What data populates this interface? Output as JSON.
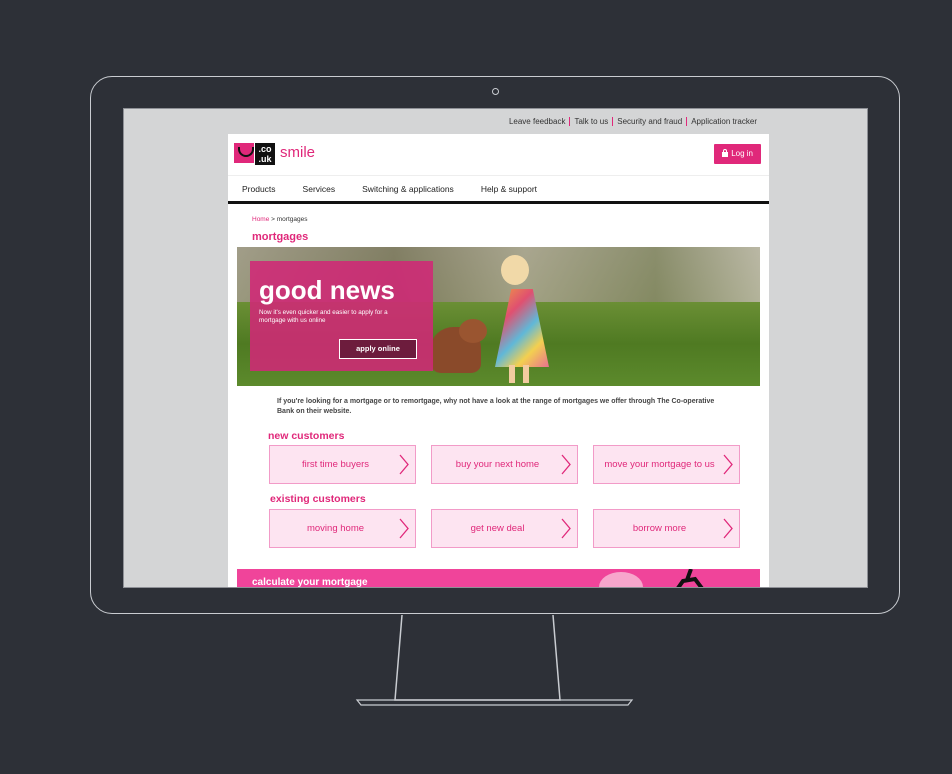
{
  "top_links": [
    "Leave feedback",
    "Talk to us",
    "Security and fraud",
    "Application tracker"
  ],
  "logo": {
    "couk": ".co\n.uk",
    "text": "smile"
  },
  "header": {
    "login_label": "Log in"
  },
  "nav": [
    "Products",
    "Services",
    "Switching & applications",
    "Help & support"
  ],
  "breadcrumb": {
    "home": "Home",
    "sep": " > ",
    "current": "mortgages"
  },
  "page_title": "mortgages",
  "hero": {
    "title": "good news",
    "subtitle": "Now it's even quicker and easier to apply for a mortgage with us online",
    "button": "apply online"
  },
  "intro": "If you're looking for a mortgage or to remortgage, why not have a look at the range of mortgages we offer through The Co-operative Bank on their website.",
  "new_customers": {
    "heading": "new customers",
    "tiles": [
      "first time buyers",
      "buy your next home",
      "move your mortgage to us"
    ]
  },
  "existing_customers": {
    "heading": "existing customers",
    "tiles": [
      "moving home",
      "get new deal",
      "borrow more"
    ]
  },
  "calc_banner": "calculate your mortgage",
  "colors": {
    "brand_pink": "#e0287a",
    "banner_pink": "#f0449a",
    "tile_bg": "#fde4f1",
    "frame_bg": "#2d3037"
  }
}
